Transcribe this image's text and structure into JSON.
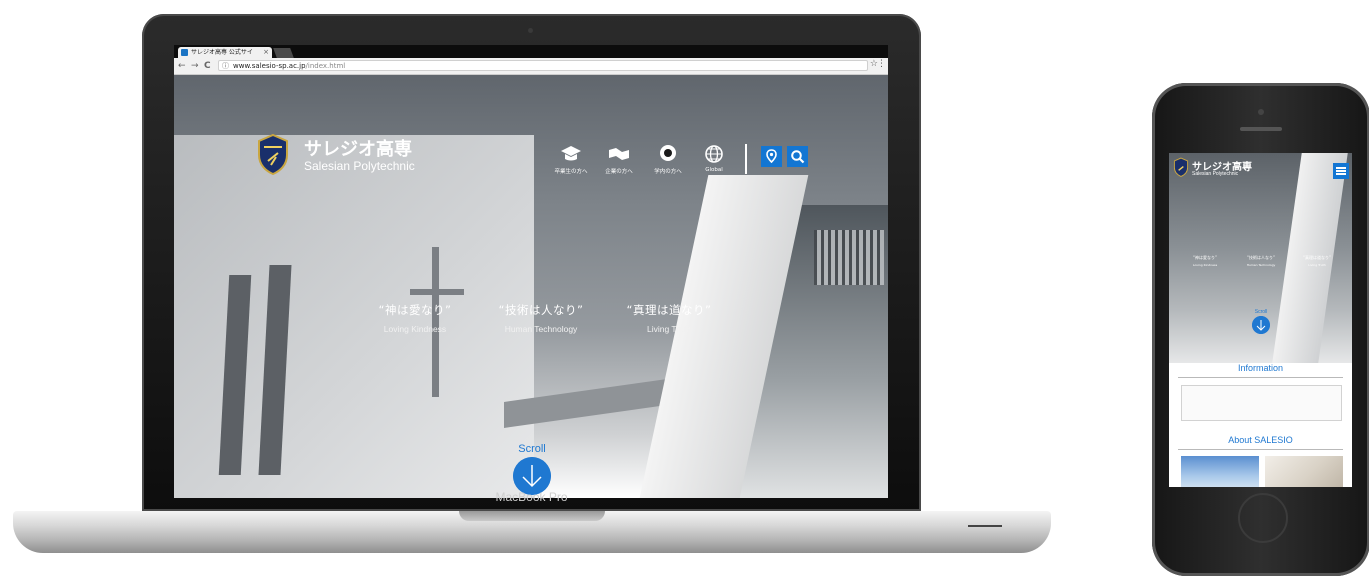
{
  "browser": {
    "tab_title": "サレジオ高専 公式サイ",
    "tab_close": "×",
    "url_host": "www.salesio-sp.ac.jp",
    "url_path": "/index.html",
    "back": "←",
    "forward": "→",
    "reload": "C",
    "info": "ⓘ",
    "star": "☆",
    "menu": "⋮"
  },
  "site": {
    "logo_jp": "サレジオ高専",
    "logo_en": "Salesian Polytechnic",
    "nav": [
      {
        "label": "卒業生の方へ",
        "icon": "graduation-cap-icon"
      },
      {
        "label": "企業の方へ",
        "icon": "handshake-icon"
      },
      {
        "label": "学内の方へ",
        "icon": "campus-icon"
      },
      {
        "label": "Global",
        "icon": "globe-icon"
      }
    ],
    "access_icon": "map-pin-icon",
    "search_icon": "search-icon",
    "mottos": [
      {
        "jp": "“神は愛なり”",
        "en": "Loving Kindness"
      },
      {
        "jp": "“技術は人なり”",
        "en": "Human Technology"
      },
      {
        "jp": "“真理は道なり”",
        "en": "Living Truth"
      }
    ],
    "scroll_label": "Scroll"
  },
  "device": {
    "laptop_model": "MacBook Pro"
  },
  "mobile": {
    "logo_jp": "サレジオ高専",
    "logo_en": "Salesian Polytechnic",
    "mottos": [
      {
        "jp": "“神は愛なり”",
        "en": "Loving Kindness"
      },
      {
        "jp": "“技術は人なり”",
        "en": "Human Technology"
      },
      {
        "jp": "“真理は道なり”",
        "en": "Living Truth"
      }
    ],
    "scroll_label": "Scroll",
    "information_title": "Information",
    "about_title": "About SALESIO"
  },
  "colors": {
    "accent": "#1376d3",
    "scroll_blue": "#1f78d1"
  }
}
